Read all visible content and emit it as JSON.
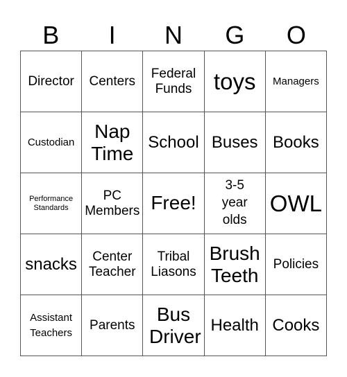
{
  "header": {
    "letters": [
      "B",
      "I",
      "N",
      "G",
      "O"
    ]
  },
  "cells": [
    [
      "Director",
      "Centers",
      "Federal Funds",
      "toys",
      "Managers"
    ],
    [
      "Custodian",
      "Nap Time",
      "School",
      "Buses",
      "Books"
    ],
    [
      "Performance Standards",
      "PC Members",
      "Free!",
      "3-5 year olds",
      "OWL"
    ],
    [
      "snacks",
      "Center Teacher",
      "Tribal Liasons",
      "Brush Teeth",
      "Policies"
    ],
    [
      "Assistant Teachers",
      "Parents",
      "Bus Driver",
      "Health",
      "Cooks"
    ]
  ]
}
